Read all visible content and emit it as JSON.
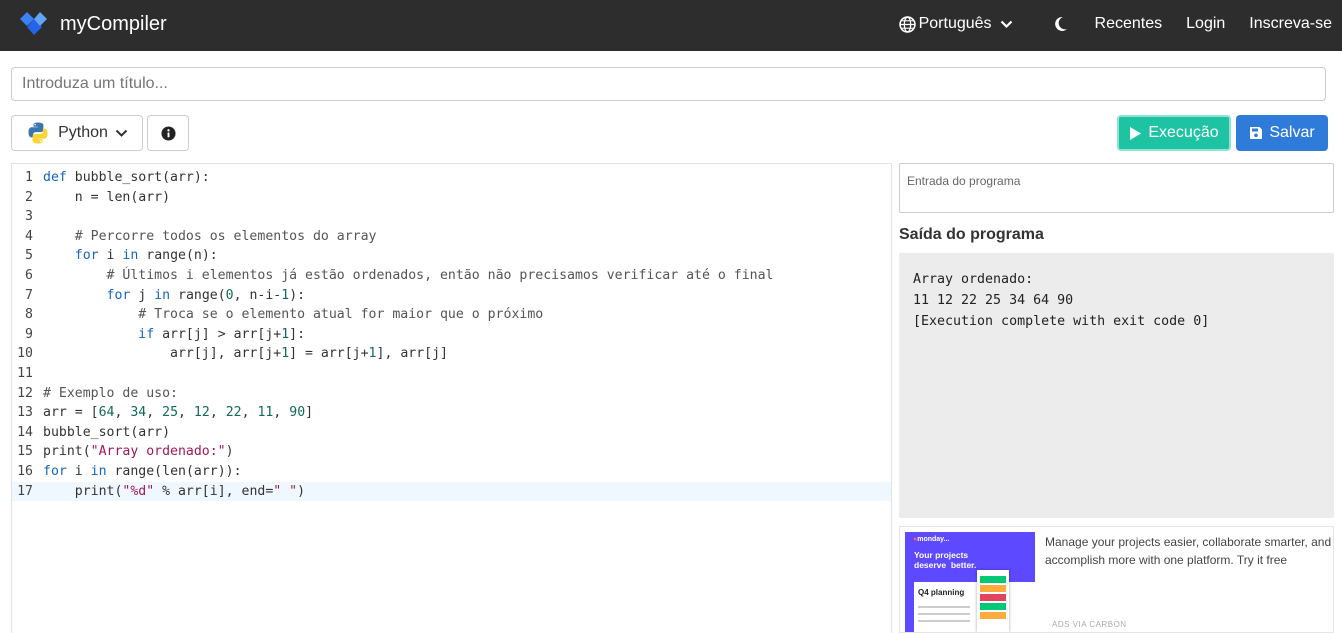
{
  "header": {
    "brand": "myCompiler",
    "language_selector": "Português",
    "nav": {
      "recent": "Recentes",
      "login": "Login",
      "signup": "Inscreva-se"
    }
  },
  "title_input": {
    "placeholder": "Introduza um título..."
  },
  "toolbar": {
    "language": "Python",
    "run_label": "Execução",
    "save_label": "Salvar"
  },
  "editor": {
    "active_line": 17,
    "lines": [
      "def bubble_sort(arr):",
      "    n = len(arr)",
      "",
      "    # Percorre todos os elementos do array",
      "    for i in range(n):",
      "        # Últimos i elementos já estão ordenados, então não precisamos verificar até o final",
      "        for j in range(0, n-i-1):",
      "            # Troca se o elemento atual for maior que o próximo",
      "            if arr[j] > arr[j+1]:",
      "                arr[j], arr[j+1] = arr[j+1], arr[j]",
      "",
      "# Exemplo de uso:",
      "arr = [64, 34, 25, 12, 22, 11, 90]",
      "bubble_sort(arr)",
      "print(\"Array ordenado:\")",
      "for i in range(len(arr)):",
      "    print(\"%d\" % arr[i], end=\" \")"
    ]
  },
  "stdin": {
    "placeholder": "Entrada do programa"
  },
  "output": {
    "title": "Saída do programa",
    "lines": [
      "Array ordenado:",
      "11 12 22 25 34 64 90",
      "[Execution complete with exit code 0]"
    ]
  },
  "ad": {
    "text": "Manage your projects easier, collaborate smarter, and accomplish more with one platform. Try it free",
    "via": "ADS VIA CARBON",
    "image": {
      "brand": "monday",
      "headline_1": "Your projects",
      "headline_2": "deserve  better.",
      "card_title": "Q4 planning"
    }
  },
  "colors": {
    "header_bg": "#2d2d2d",
    "run_button": "#1ec3a4",
    "save_button": "#2f7bd9",
    "keyword": "#1565c0",
    "string": "#a1175b",
    "number": "#106b59",
    "output_bg": "#ececec"
  },
  "icons": [
    "mycompiler-logo-icon",
    "globe-icon",
    "chevron-down-icon",
    "moon-icon",
    "python-logo-icon",
    "info-icon",
    "play-icon",
    "floppy-disk-icon"
  ]
}
